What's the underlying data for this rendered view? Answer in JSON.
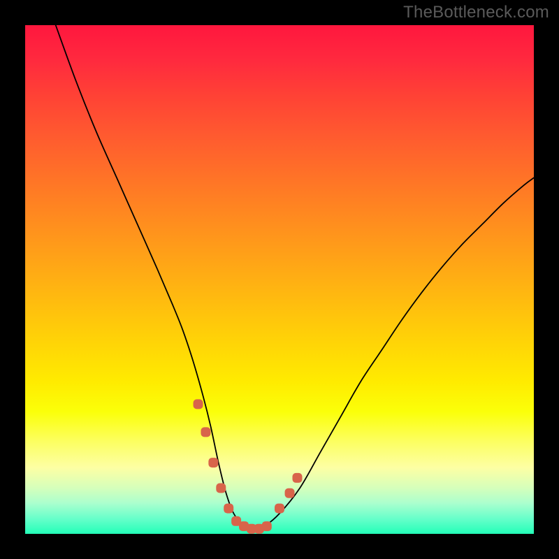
{
  "watermark": "TheBottleneck.com",
  "chart_data": {
    "type": "line",
    "title": "",
    "xlabel": "",
    "ylabel": "",
    "ylim": [
      0,
      100
    ],
    "xlim": [
      0,
      100
    ],
    "series": [
      {
        "name": "bottleneck-curve",
        "x": [
          6,
          10,
          14,
          18,
          22,
          26,
          29,
          31,
          33,
          35,
          36.5,
          38,
          39.5,
          41,
          43,
          45,
          47,
          50,
          54,
          58,
          62,
          66,
          70,
          74,
          78,
          82,
          86,
          90,
          94,
          98,
          100
        ],
        "values": [
          100,
          89,
          79,
          70,
          61,
          52,
          45,
          40,
          34,
          27,
          21,
          14,
          8,
          4,
          1.5,
          1,
          1.5,
          4,
          9,
          16,
          23,
          30,
          36,
          42,
          47.5,
          52.5,
          57,
          61,
          65,
          68.5,
          70
        ]
      }
    ],
    "markers": [
      {
        "name": "left-marker-cluster",
        "color": "#d8644a",
        "points": [
          {
            "x": 34.0,
            "y": 25.5
          },
          {
            "x": 35.5,
            "y": 20.0
          },
          {
            "x": 37.0,
            "y": 14.0
          },
          {
            "x": 38.5,
            "y": 9.0
          },
          {
            "x": 40.0,
            "y": 5.0
          }
        ]
      },
      {
        "name": "bottom-marker-cluster",
        "color": "#d8644a",
        "points": [
          {
            "x": 41.5,
            "y": 2.5
          },
          {
            "x": 43.0,
            "y": 1.5
          },
          {
            "x": 44.5,
            "y": 1.0
          },
          {
            "x": 46.0,
            "y": 1.0
          },
          {
            "x": 47.5,
            "y": 1.5
          }
        ]
      },
      {
        "name": "right-marker-cluster",
        "color": "#d8644a",
        "points": [
          {
            "x": 50.0,
            "y": 5.0
          },
          {
            "x": 52.0,
            "y": 8.0
          },
          {
            "x": 53.5,
            "y": 11.0
          }
        ]
      }
    ]
  }
}
